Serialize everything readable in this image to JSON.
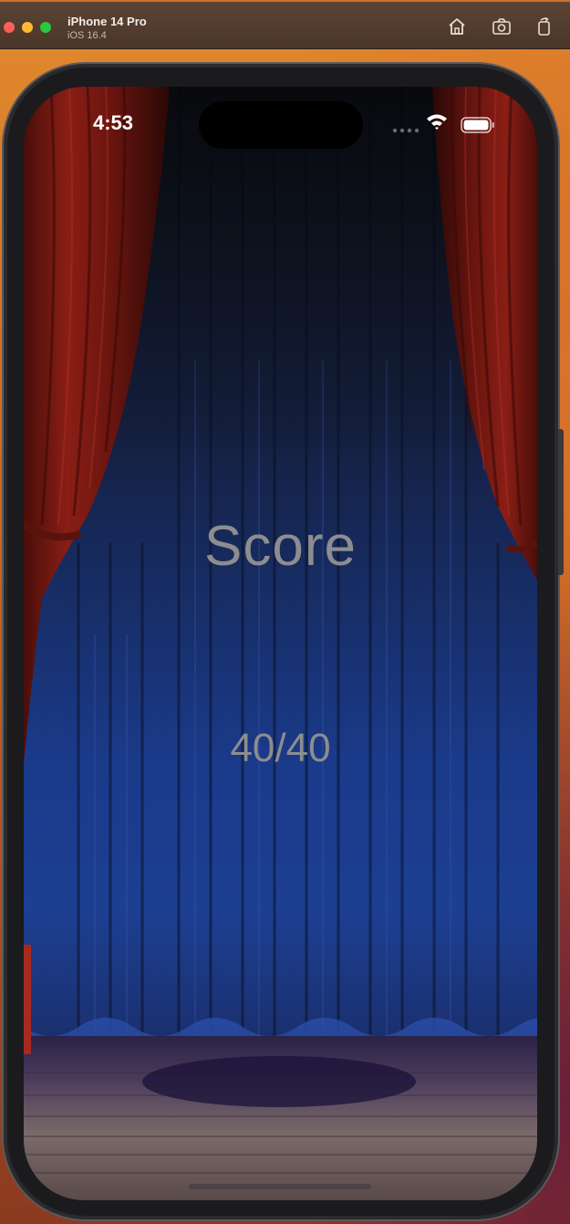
{
  "simulator": {
    "device_name": "iPhone 14 Pro",
    "os_version": "iOS 16.4",
    "toolbar_icons": [
      "home-icon",
      "screenshot-icon",
      "rotate-icon"
    ]
  },
  "status_bar": {
    "time": "4:53",
    "icons": [
      "wifi-icon",
      "battery-icon"
    ]
  },
  "score_screen": {
    "title": "Score",
    "score": "40/40"
  },
  "colors": {
    "score_text": "#8d8d90",
    "curtain_blue": "#1a3a8a",
    "curtain_red": "#8a1e16",
    "stage_floor": "#6b5a5a"
  }
}
